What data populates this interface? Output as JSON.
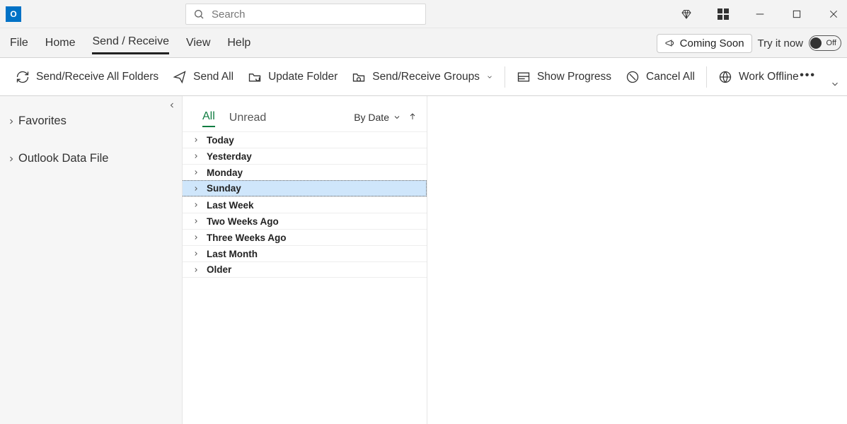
{
  "search": {
    "placeholder": "Search"
  },
  "menu": {
    "tabs": [
      "File",
      "Home",
      "Send / Receive",
      "View",
      "Help"
    ],
    "active_index": 2,
    "coming_soon": "Coming Soon",
    "try_it": "Try it now",
    "toggle_label": "Off"
  },
  "ribbon": {
    "send_receive_all": "Send/Receive All Folders",
    "send_all": "Send All",
    "update_folder": "Update Folder",
    "groups": "Send/Receive Groups",
    "show_progress": "Show Progress",
    "cancel_all": "Cancel All",
    "work_offline": "Work Offline"
  },
  "sidebar": {
    "favorites": "Favorites",
    "data_file": "Outlook Data File"
  },
  "list": {
    "tab_all": "All",
    "tab_unread": "Unread",
    "sort_label": "By Date",
    "groups": [
      "Today",
      "Yesterday",
      "Monday",
      "Sunday",
      "Last Week",
      "Two Weeks Ago",
      "Three Weeks Ago",
      "Last Month",
      "Older"
    ],
    "selected_index": 3
  }
}
